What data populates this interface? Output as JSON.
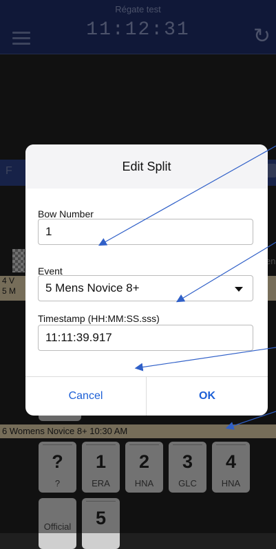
{
  "header": {
    "regatta_name": "Régate test",
    "clock": "11:12:31"
  },
  "background": {
    "blue_bar_text": "F",
    "row_a_text": "4 V",
    "row_b_text": "5 M",
    "en_text": "en",
    "event_bar_text": "6 Womens Novice 8+ 10:30 AM",
    "tiles": [
      {
        "num": "?",
        "club": "?"
      },
      {
        "num": "1",
        "club": "ERA"
      },
      {
        "num": "2",
        "club": "HNA"
      },
      {
        "num": "3",
        "club": "GLC"
      },
      {
        "num": "4",
        "club": "HNA"
      },
      {
        "num": "",
        "club": "Official"
      },
      {
        "num": "5",
        "club": ""
      }
    ]
  },
  "dialog": {
    "title": "Edit Split",
    "bow_label": "Bow Number",
    "bow_value": "1",
    "event_label": "Event",
    "event_value": "5 Mens Novice 8+",
    "timestamp_label": "Timestamp (HH:MM:SS.sss)",
    "timestamp_value": "11:11:39.917",
    "cancel_label": "Cancel",
    "ok_label": "OK"
  },
  "colors": {
    "header": "#1e2d66",
    "accent": "#1c5fd6",
    "event_bar": "#d7c7a2",
    "arrow": "#3060c8"
  }
}
